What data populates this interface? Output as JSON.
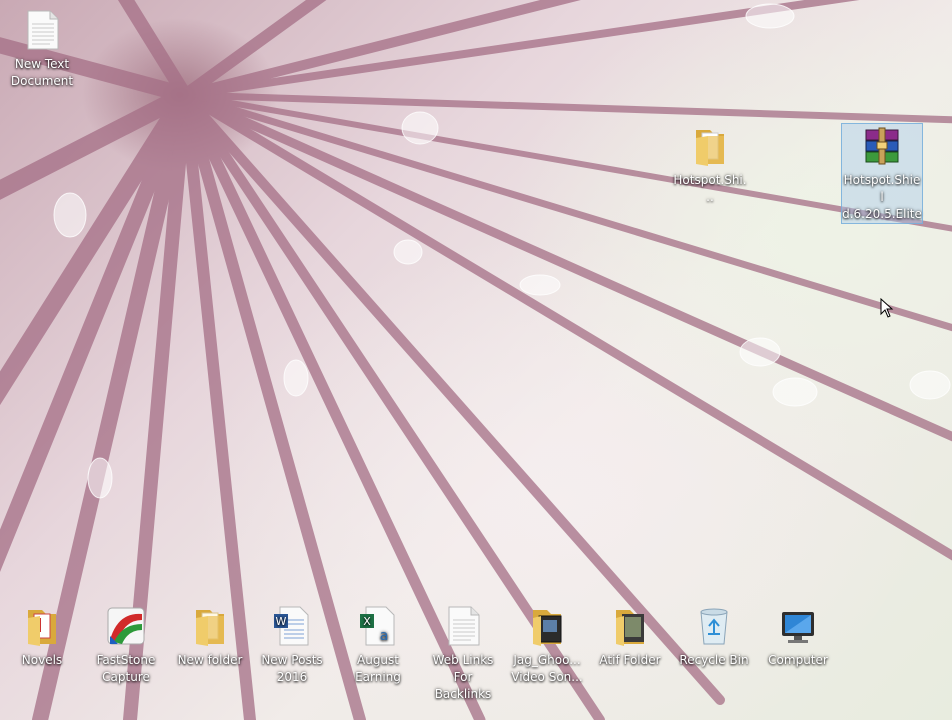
{
  "desktop": {
    "top_icons": [
      {
        "label_1": "New Text",
        "label_2": "Document",
        "icon": "text-document-icon"
      },
      {
        "label_1": "Hotspot.Shi...",
        "label_2": "",
        "icon": "folder-icon"
      },
      {
        "label_1": "Hotspot.Shiel",
        "label_2": "d.6.20.5.Elite",
        "icon": "winrar-archive-icon"
      }
    ],
    "bottom_icons": [
      {
        "label_1": "Novels",
        "label_2": "",
        "icon": "folder-icon"
      },
      {
        "label_1": "FastStone",
        "label_2": "Capture",
        "icon": "faststone-capture-icon"
      },
      {
        "label_1": "New folder",
        "label_2": "",
        "icon": "folder-icon"
      },
      {
        "label_1": "New Posts",
        "label_2": "2016",
        "icon": "word-document-icon"
      },
      {
        "label_1": "August",
        "label_2": "Earning",
        "icon": "excel-document-icon"
      },
      {
        "label_1": "Web Links",
        "label_2": "For Backlinks",
        "icon": "text-document-icon"
      },
      {
        "label_1": "Jag_Ghoo...",
        "label_2": "Video Son...",
        "icon": "video-folder-icon"
      },
      {
        "label_1": "Atif Folder",
        "label_2": "",
        "icon": "folder-icon"
      },
      {
        "label_1": "Recycle Bin",
        "label_2": "",
        "icon": "recycle-bin-icon"
      },
      {
        "label_1": "Computer",
        "label_2": "",
        "icon": "computer-icon"
      }
    ]
  },
  "colors": {
    "folder": "#e9c15a",
    "selection": "#aacdeb",
    "label_text": "#ffffff"
  }
}
